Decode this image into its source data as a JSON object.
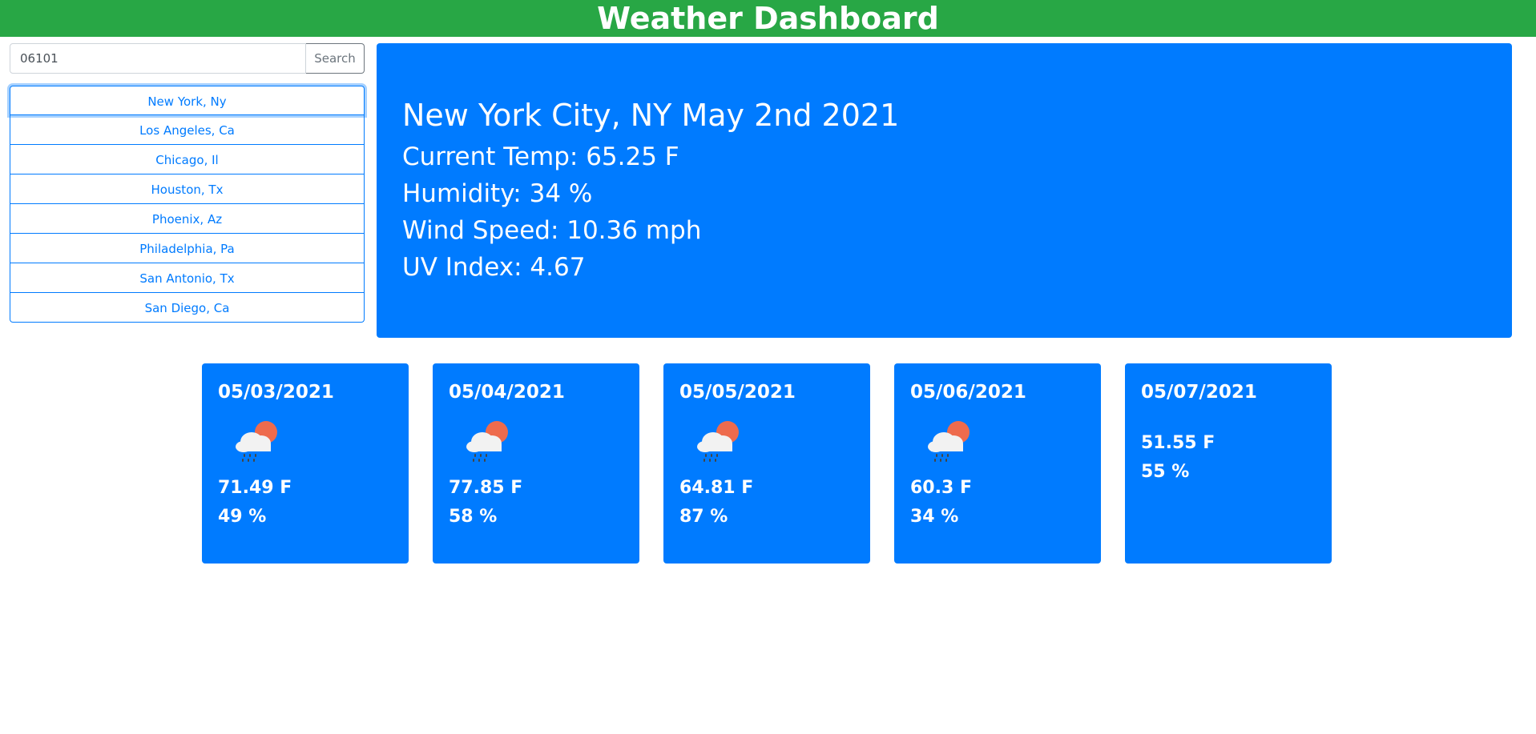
{
  "header": {
    "title": "Weather Dashboard"
  },
  "search": {
    "value": "06101",
    "button_label": "Search"
  },
  "cities": [
    {
      "label": "New York, Ny"
    },
    {
      "label": "Los Angeles, Ca"
    },
    {
      "label": "Chicago, Il"
    },
    {
      "label": "Houston, Tx"
    },
    {
      "label": "Phoenix, Az"
    },
    {
      "label": "Philadelphia, Pa"
    },
    {
      "label": "San Antonio, Tx"
    },
    {
      "label": "San Diego, Ca"
    }
  ],
  "current": {
    "title": "New York City, NY May 2nd 2021",
    "temp": "Current Temp: 65.25 F",
    "humidity": "Humidity: 34 %",
    "wind": "Wind Speed: 10.36 mph",
    "uv": "UV Index: 4.67"
  },
  "forecast": [
    {
      "date": "05/03/2021",
      "icon": "rain-cloud-sun-icon",
      "temp": "71.49 F",
      "humidity": "49 %"
    },
    {
      "date": "05/04/2021",
      "icon": "rain-cloud-sun-icon",
      "temp": "77.85 F",
      "humidity": "58 %"
    },
    {
      "date": "05/05/2021",
      "icon": "rain-cloud-sun-icon",
      "temp": "64.81 F",
      "humidity": "87 %"
    },
    {
      "date": "05/06/2021",
      "icon": "rain-cloud-sun-icon",
      "temp": "60.3 F",
      "humidity": "34 %"
    },
    {
      "date": "05/07/2021",
      "icon": "",
      "temp": "51.55 F",
      "humidity": "55 %"
    }
  ],
  "colors": {
    "header_bg": "#28a745",
    "primary": "#007bff",
    "sun": "#ee6b4d",
    "cloud": "#f2f2f2"
  }
}
